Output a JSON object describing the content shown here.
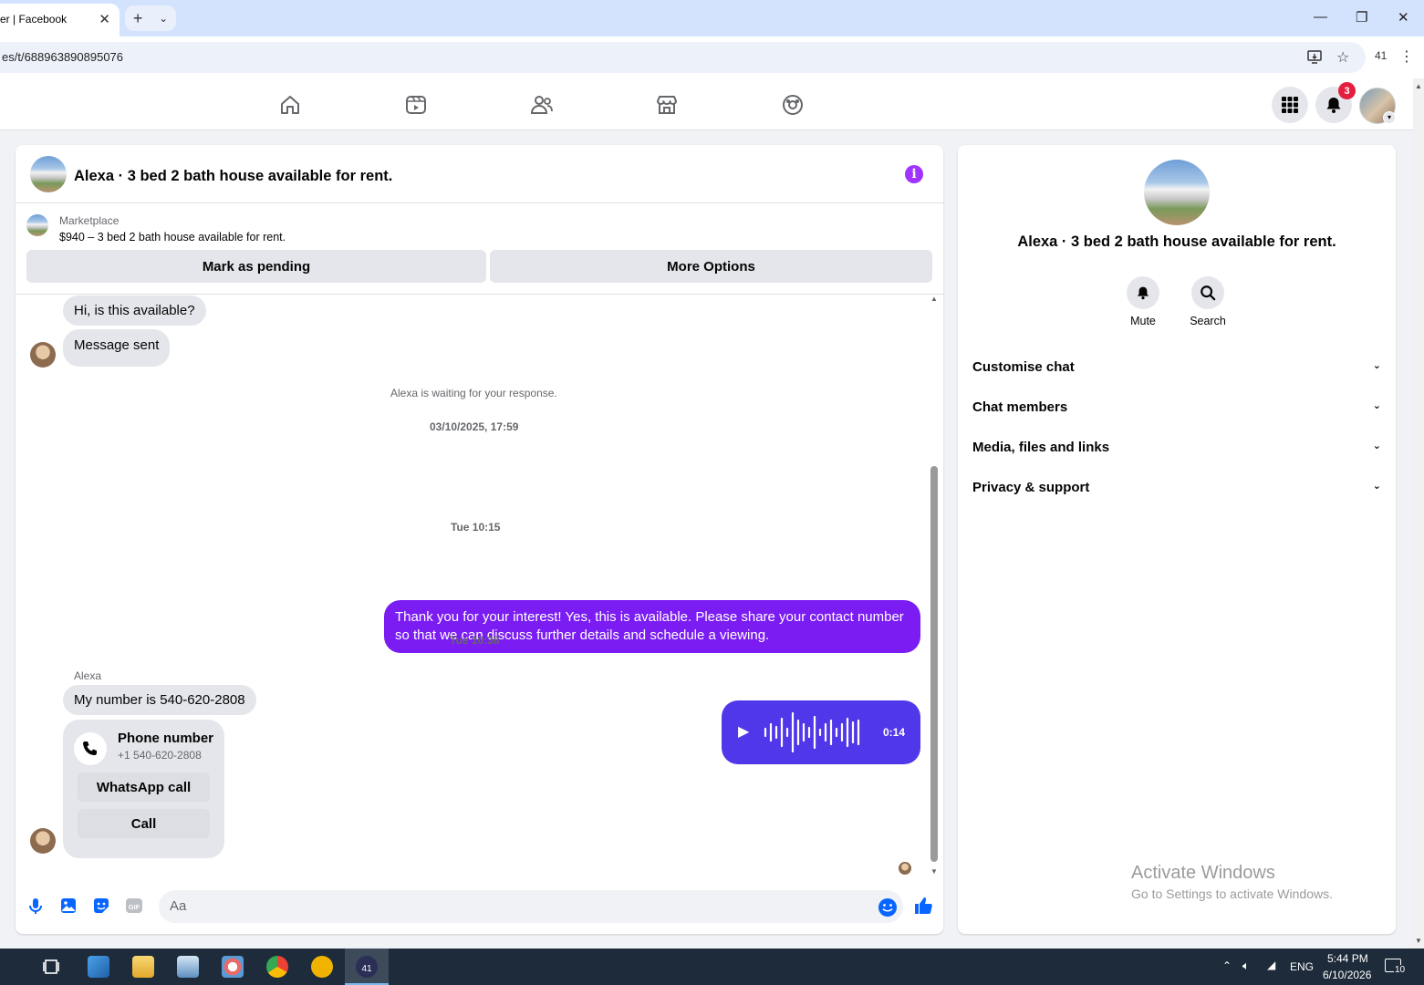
{
  "browser": {
    "tab_title": "er | Facebook",
    "url": "es/t/688963890895076",
    "profile_count": "41"
  },
  "fb": {
    "notification_count": "3"
  },
  "chat": {
    "title": "Alexa · 3 bed 2 bath house available for rent.",
    "marketplace_label": "Marketplace",
    "listing": "$940 – 3 bed 2 bath house available for rent.",
    "btn_pending": "Mark as pending",
    "btn_more": "More Options",
    "messages": {
      "m1": "Hi, is this available?",
      "m2": "Message sent",
      "waiting": "Alexa is waiting for your response.",
      "stamp1": "03/10/2025, 17:59",
      "out1": "Thank you for your interest! Yes, this is available. Please share your contact number so that we can discuss further details and schedule a viewing.",
      "stamp2": "Tue 10:15",
      "voice_duration": "0:14",
      "stamp3": "Tue 10:38",
      "sender": "Alexa",
      "m3": "My number is 540-620-2808",
      "card_title": "Phone number",
      "card_number": "+1 540-620-2808",
      "card_whatsapp": "WhatsApp call",
      "card_call": "Call"
    },
    "composer_placeholder": "Aa"
  },
  "info_panel": {
    "name": "Alexa · 3 bed 2 bath house available for rent.",
    "mute": "Mute",
    "search": "Search",
    "sections": [
      "Customise chat",
      "Chat members",
      "Media, files and links",
      "Privacy & support"
    ]
  },
  "watermark": {
    "line1": "Activate Windows",
    "line2": "Go to Settings to activate Windows."
  },
  "taskbar": {
    "lang": "ENG",
    "time": "5:44 PM",
    "date": "6/10/2026",
    "chrome_badge": "41",
    "notif_count": "10"
  },
  "colors": {
    "accent": "#7a1cf2",
    "voice": "#5038ea",
    "fb_blue": "#0866ff",
    "badge": "#e41e3f"
  }
}
